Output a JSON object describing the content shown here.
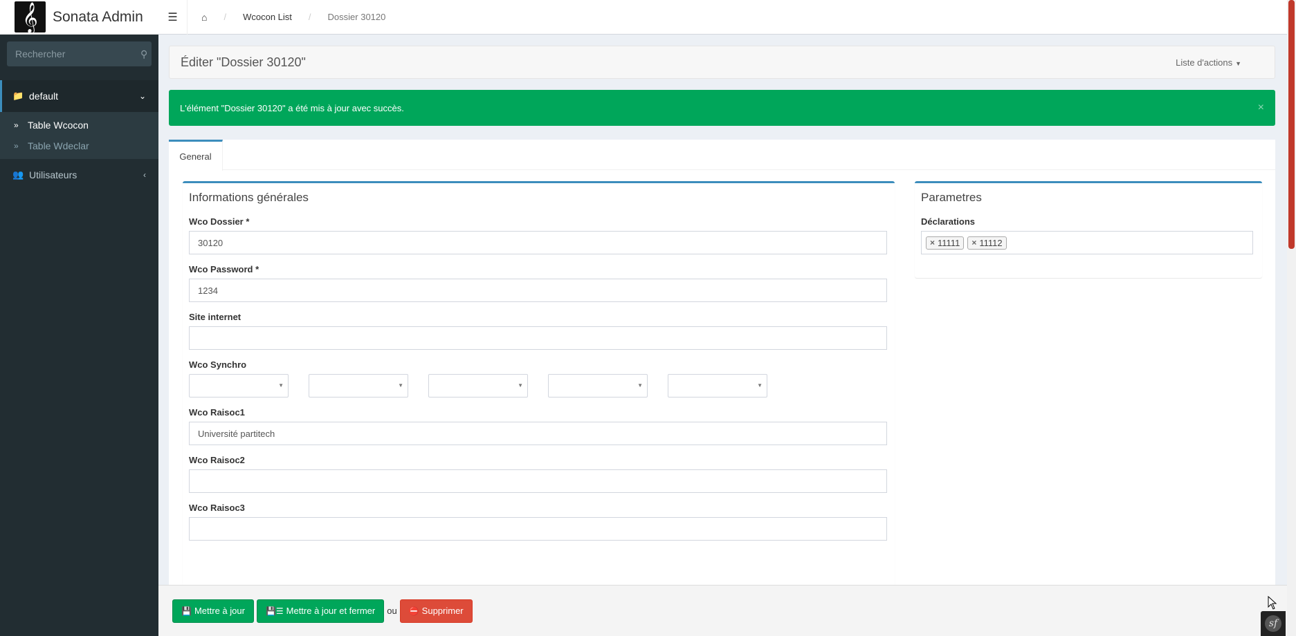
{
  "app": {
    "name": "Sonata Admin",
    "logo_glyph": "𝄞"
  },
  "sidebar": {
    "search_placeholder": "Rechercher",
    "groups": [
      {
        "label": "default",
        "icon": "folder-icon",
        "items": [
          {
            "label": "Table Wcocon"
          },
          {
            "label": "Table Wdeclar"
          }
        ]
      },
      {
        "label": "Utilisateurs",
        "icon": "users-icon"
      }
    ]
  },
  "breadcrumb": {
    "list": "Wcocon List",
    "current": "Dossier 30120"
  },
  "page": {
    "title": "Éditer \"Dossier 30120\"",
    "actions_label": "Liste d'actions"
  },
  "alert": {
    "message": "L'élément \"Dossier 30120\" a été mis à jour avec succès.",
    "close": "×",
    "color": "#00a65a"
  },
  "tabs": [
    {
      "label": "General"
    }
  ],
  "general_box": {
    "title": "Informations générales",
    "fields": {
      "dossier": {
        "label": "Wco Dossier *",
        "value": "30120"
      },
      "password": {
        "label": "Wco Password *",
        "value": "1234"
      },
      "site": {
        "label": "Site internet",
        "value": ""
      },
      "synchro": {
        "label": "Wco Synchro"
      },
      "raisoc1": {
        "label": "Wco Raisoc1",
        "value": "Université partitech"
      },
      "raisoc2": {
        "label": "Wco Raisoc2",
        "value": ""
      },
      "raisoc3": {
        "label": "Wco Raisoc3",
        "value": ""
      }
    }
  },
  "params_box": {
    "title": "Parametres",
    "declarations_label": "Déclarations",
    "tags": [
      "11111",
      "11112"
    ]
  },
  "footer": {
    "update": "Mettre à jour",
    "update_close": "Mettre à jour et fermer",
    "or": "ou",
    "delete": "Supprimer"
  },
  "colors": {
    "accent": "#3c8dbc",
    "success": "#00a65a",
    "danger": "#dd4b39",
    "sidebar": "#222d32"
  }
}
